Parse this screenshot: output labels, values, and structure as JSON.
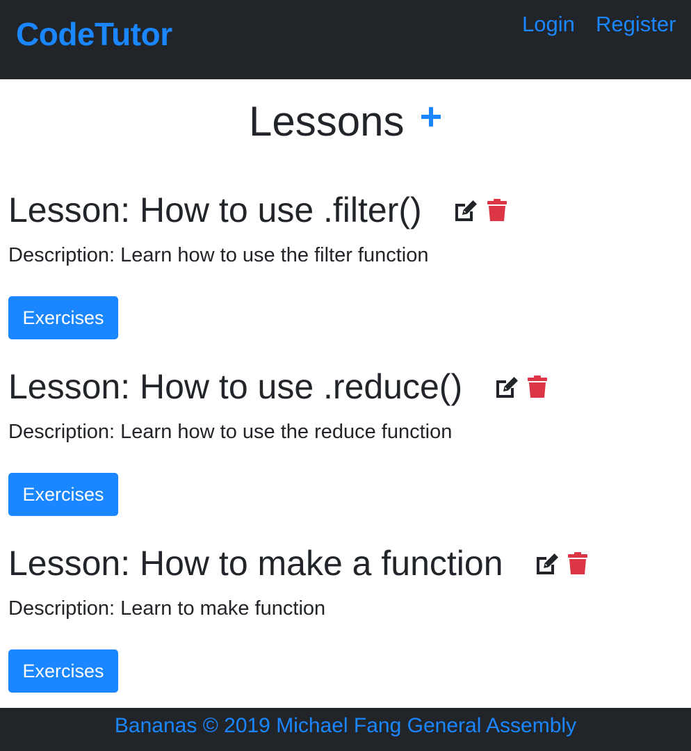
{
  "navbar": {
    "brand": "CodeTutor",
    "links": {
      "login": "Login",
      "register": "Register"
    }
  },
  "page": {
    "title": "Lessons",
    "add_icon": "plus-icon"
  },
  "lessons": [
    {
      "title": "Lesson: How to use .filter()",
      "description": "Description: Learn how to use the filter function",
      "button_label": "Exercises"
    },
    {
      "title": "Lesson: How to use .reduce()",
      "description": "Description: Learn how to use the reduce function",
      "button_label": "Exercises"
    },
    {
      "title": "Lesson: How to make a function",
      "description": "Description: Learn to make function",
      "button_label": "Exercises"
    }
  ],
  "icons": {
    "edit": "edit-icon",
    "delete": "trash-icon"
  },
  "colors": {
    "accent": "#1a86ff",
    "dark": "#212529",
    "danger": "#dc3545"
  },
  "footer": {
    "text": "Bananas © 2019 Michael Fang General Assembly"
  }
}
